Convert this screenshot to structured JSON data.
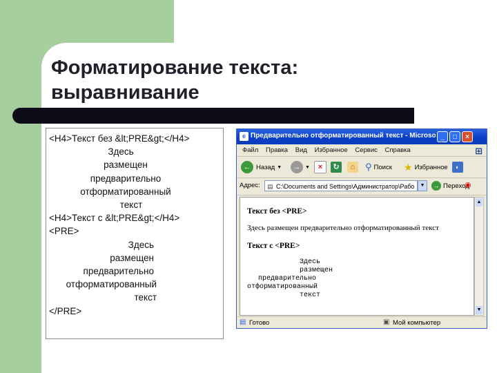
{
  "slide": {
    "title_line1": "Форматирование текста:",
    "title_line2": "выравнивание"
  },
  "code": {
    "lines": [
      "<H4>Текст без &lt;PRE&gt;</H4>",
      "Здесь",
      "размещен",
      "предварительно",
      "отформатированный",
      "текст",
      "<H4>Текст с &lt;PRE&gt;</H4>",
      "<PRE>",
      "Здесь",
      "размещен",
      "предварительно",
      "отформатированный",
      "текст",
      "</PRE>"
    ]
  },
  "browser": {
    "title": "Предварительно отформатированный текст - Microsoft I...",
    "menu": [
      "Файл",
      "Правка",
      "Вид",
      "Избранное",
      "Сервис",
      "Справка"
    ],
    "toolbar": {
      "back_label": "Назад",
      "search_label": "Поиск",
      "favorites_label": "Избранное"
    },
    "address": {
      "label": "Адрес:",
      "value": "C:\\Documents and Settings\\Администратор\\Рабо",
      "go_label": "Переход"
    },
    "content": {
      "heading1": "Текст без <PRE>",
      "paragraph": "Здесь размещен предварительно отформатированный текст",
      "heading2": "Текст с <PRE>",
      "pre_lines": [
        "Здесь",
        "размещен",
        "предварительно",
        "отформатированный",
        "текст"
      ]
    },
    "status": {
      "left": "Готово",
      "right": "Мой компьютер"
    },
    "colors": {
      "titlebar": "#0a3fc9",
      "chrome": "#ece9d8"
    }
  }
}
